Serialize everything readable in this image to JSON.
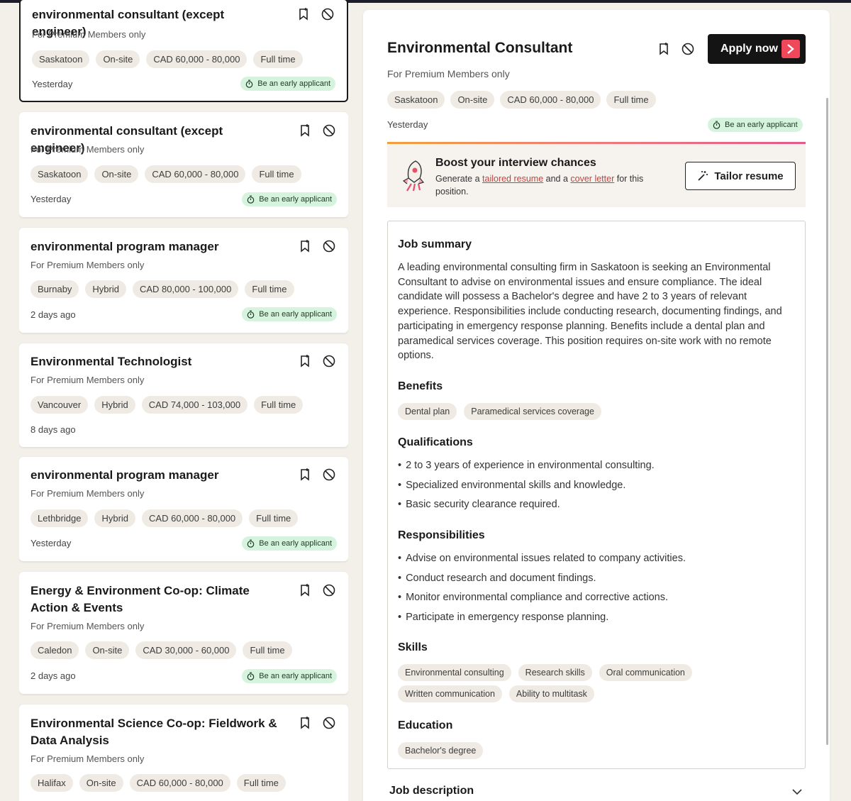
{
  "jobs": [
    {
      "title": "environmental consultant (except engineer)",
      "subtitle": "For Premium Members only",
      "location": "Saskatoon",
      "mode": "On-site",
      "salary": "CAD 60,000 - 80,000",
      "type": "Full time",
      "posted": "Yesterday",
      "early_badge": "Be an early applicant"
    },
    {
      "title": "environmental consultant (except engineer)",
      "subtitle": "For Premium Members only",
      "location": "Saskatoon",
      "mode": "On-site",
      "salary": "CAD 60,000 - 80,000",
      "type": "Full time",
      "posted": "Yesterday",
      "early_badge": "Be an early applicant"
    },
    {
      "title": "environmental program manager",
      "subtitle": "For Premium Members only",
      "location": "Burnaby",
      "mode": "Hybrid",
      "salary": "CAD 80,000 - 100,000",
      "type": "Full time",
      "posted": "2 days ago",
      "early_badge": "Be an early applicant"
    },
    {
      "title": "Environmental Technologist",
      "subtitle": "For Premium Members only",
      "location": "Vancouver",
      "mode": "Hybrid",
      "salary": "CAD 74,000 - 103,000",
      "type": "Full time",
      "posted": "8 days ago",
      "early_badge": ""
    },
    {
      "title": "environmental program manager",
      "subtitle": "For Premium Members only",
      "location": "Lethbridge",
      "mode": "Hybrid",
      "salary": "CAD 60,000 - 80,000",
      "type": "Full time",
      "posted": "Yesterday",
      "early_badge": "Be an early applicant"
    },
    {
      "title": "Energy & Environment Co-op: Climate Action & Events",
      "subtitle": "For Premium Members only",
      "location": "Caledon",
      "mode": "On-site",
      "salary": "CAD 30,000 - 60,000",
      "type": "Full time",
      "posted": "2 days ago",
      "early_badge": "Be an early applicant"
    },
    {
      "title": "Environmental Science Co-op: Fieldwork & Data Analysis",
      "subtitle": "For Premium Members only",
      "location": "Halifax",
      "mode": "On-site",
      "salary": "CAD 60,000 - 80,000",
      "type": "Full time",
      "posted": "",
      "early_badge": ""
    }
  ],
  "detail": {
    "title": "Environmental Consultant",
    "subtitle": "For Premium Members only",
    "apply_label": "Apply now",
    "tags": [
      "Saskatoon",
      "On-site",
      "CAD 60,000 - 80,000",
      "Full time"
    ],
    "posted": "Yesterday",
    "early_badge": "Be an early applicant",
    "boost": {
      "title": "Boost your interview chances",
      "text_1": "Generate a ",
      "link_1": "tailored resume",
      "text_2": " and a ",
      "link_2": "cover letter",
      "text_3": " for this position.",
      "button": "Tailor resume"
    },
    "job_summary_heading": "Job summary",
    "job_summary": "A leading environmental consulting firm in Saskatoon is seeking an Environmental Consultant to advise on environmental issues and ensure compliance. The ideal candidate will possess a Bachelor's degree and have 2 to 3 years of relevant experience. Responsibilities include conducting research, documenting findings, and participating in emergency response planning. Benefits include a dental plan and paramedical services coverage. This position requires on-site work with no remote options.",
    "benefits_heading": "Benefits",
    "benefits": [
      "Dental plan",
      "Paramedical services coverage"
    ],
    "qualifications_heading": "Qualifications",
    "qualifications": [
      "2 to 3 years of experience in environmental consulting.",
      "Specialized environmental skills and knowledge.",
      "Basic security clearance required."
    ],
    "responsibilities_heading": "Responsibilities",
    "responsibilities": [
      "Advise on environmental issues related to company activities.",
      "Conduct research and document findings.",
      "Monitor environmental compliance and corrective actions.",
      "Participate in emergency response planning."
    ],
    "skills_heading": "Skills",
    "skills": [
      "Environmental consulting",
      "Research skills",
      "Oral communication",
      "Written communication",
      "Ability to multitask"
    ],
    "education_heading": "Education",
    "education": [
      "Bachelor's degree"
    ],
    "job_description_heading": "Job description"
  },
  "colors": {
    "accent": "#f0485a",
    "early_bg": "#d6f3dd",
    "tag_bg": "#efebe4",
    "dark": "#141414"
  }
}
